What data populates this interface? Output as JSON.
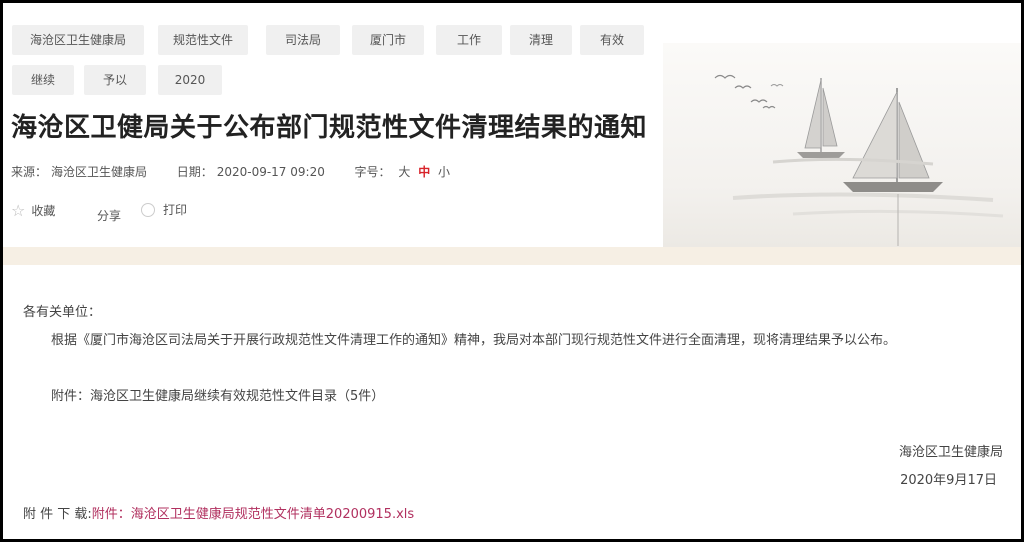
{
  "tags": [
    "海沧区卫生健康局",
    "规范性文件",
    "司法局",
    "厦门市",
    "工作",
    "清理",
    "有效",
    "继续",
    "予以",
    "2020"
  ],
  "title": "海沧区卫健局关于公布部门规范性文件清理结果的通知",
  "meta": {
    "source_label": "来源：",
    "source_value": "海沧区卫生健康局",
    "date_label": "日期：",
    "date_value": "2020-09-17 09:20",
    "fontsize_label": "字号：",
    "size_large": "大",
    "size_medium": "中",
    "size_small": "小"
  },
  "actions": {
    "favorite": "收藏",
    "share": "分享",
    "print": "打印"
  },
  "content": {
    "greeting": "各有关单位：",
    "paragraph1": "根据《厦门市海沧区司法局关于开展行政规范性文件清理工作的通知》精神，我局对本部门现行规范性文件进行全面清理，现将清理结果予以公布。",
    "paragraph2": "附件：海沧区卫生健康局继续有效规范性文件目录（5件）",
    "signature_org": "海沧区卫生健康局",
    "signature_date": "2020年9月17日",
    "download_label": "附 件 下 载:",
    "download_link": "附件：海沧区卫生健康局规范性文件清单20200915.xls"
  },
  "colors": {
    "accent": "#d8232a",
    "link": "#b1305f",
    "band": "#f6efe4"
  }
}
